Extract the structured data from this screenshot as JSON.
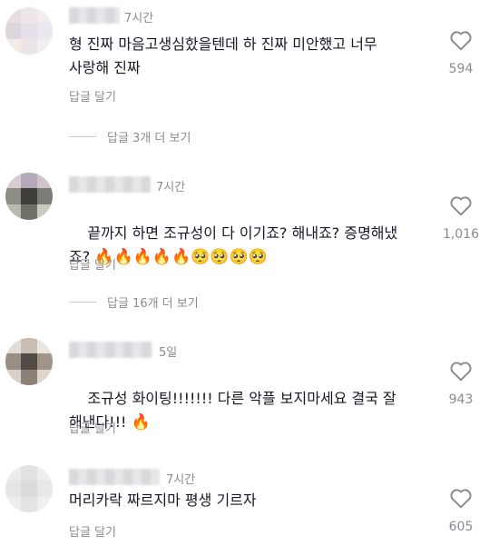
{
  "comments": [
    {
      "time": "7시간",
      "text": "형 진짜 마음고생심핬을텐데 하 진짜 미안했고 너무\n사랑해 진짜",
      "reply_label": "답글 달기",
      "more_replies": "답글 3개 더 보기",
      "likes": "594"
    },
    {
      "time": "7시간",
      "text_line1": "끝까지 하면 조규성이 다 이기죠? 해내죠? 증명해냈",
      "text_line2": "죠? ",
      "emojis": "🔥🔥🔥🔥🔥🥺🥺🥺🥺",
      "reply_label": "답글 달기",
      "more_replies": "답글 16개 더 보기",
      "likes": "1,016"
    },
    {
      "time": "5일",
      "text": "조규성 화이팅!!!!!!! 다른 악플 보지마세요 결국 잘\n해낸다!!! ",
      "emojis": "🔥",
      "reply_label": "답글 달기",
      "likes": "943"
    },
    {
      "time": "7시간",
      "text": "머리카락 짜르지마 평생 기르자",
      "reply_label": "답글 달기",
      "likes": "605"
    }
  ],
  "icons": {
    "like": "heart-outline-icon"
  },
  "colors": {
    "text": "#161823",
    "secondary": "#8a8b91",
    "background": "#ffffff"
  }
}
